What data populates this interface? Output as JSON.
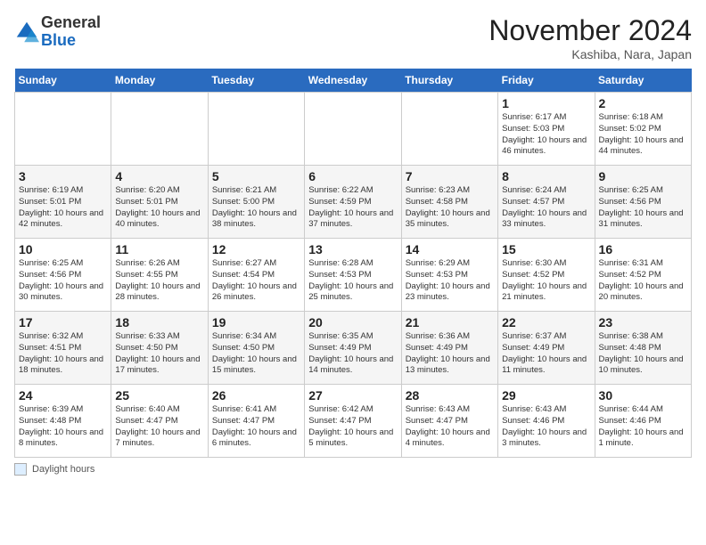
{
  "header": {
    "title": "November 2024",
    "location": "Kashiba, Nara, Japan",
    "logo_general": "General",
    "logo_blue": "Blue"
  },
  "weekdays": [
    "Sunday",
    "Monday",
    "Tuesday",
    "Wednesday",
    "Thursday",
    "Friday",
    "Saturday"
  ],
  "legend": {
    "label": "Daylight hours"
  },
  "weeks": [
    [
      {
        "date": "",
        "info": ""
      },
      {
        "date": "",
        "info": ""
      },
      {
        "date": "",
        "info": ""
      },
      {
        "date": "",
        "info": ""
      },
      {
        "date": "",
        "info": ""
      },
      {
        "date": "1",
        "info": "Sunrise: 6:17 AM\nSunset: 5:03 PM\nDaylight: 10 hours and 46 minutes."
      },
      {
        "date": "2",
        "info": "Sunrise: 6:18 AM\nSunset: 5:02 PM\nDaylight: 10 hours and 44 minutes."
      }
    ],
    [
      {
        "date": "3",
        "info": "Sunrise: 6:19 AM\nSunset: 5:01 PM\nDaylight: 10 hours and 42 minutes."
      },
      {
        "date": "4",
        "info": "Sunrise: 6:20 AM\nSunset: 5:01 PM\nDaylight: 10 hours and 40 minutes."
      },
      {
        "date": "5",
        "info": "Sunrise: 6:21 AM\nSunset: 5:00 PM\nDaylight: 10 hours and 38 minutes."
      },
      {
        "date": "6",
        "info": "Sunrise: 6:22 AM\nSunset: 4:59 PM\nDaylight: 10 hours and 37 minutes."
      },
      {
        "date": "7",
        "info": "Sunrise: 6:23 AM\nSunset: 4:58 PM\nDaylight: 10 hours and 35 minutes."
      },
      {
        "date": "8",
        "info": "Sunrise: 6:24 AM\nSunset: 4:57 PM\nDaylight: 10 hours and 33 minutes."
      },
      {
        "date": "9",
        "info": "Sunrise: 6:25 AM\nSunset: 4:56 PM\nDaylight: 10 hours and 31 minutes."
      }
    ],
    [
      {
        "date": "10",
        "info": "Sunrise: 6:25 AM\nSunset: 4:56 PM\nDaylight: 10 hours and 30 minutes."
      },
      {
        "date": "11",
        "info": "Sunrise: 6:26 AM\nSunset: 4:55 PM\nDaylight: 10 hours and 28 minutes."
      },
      {
        "date": "12",
        "info": "Sunrise: 6:27 AM\nSunset: 4:54 PM\nDaylight: 10 hours and 26 minutes."
      },
      {
        "date": "13",
        "info": "Sunrise: 6:28 AM\nSunset: 4:53 PM\nDaylight: 10 hours and 25 minutes."
      },
      {
        "date": "14",
        "info": "Sunrise: 6:29 AM\nSunset: 4:53 PM\nDaylight: 10 hours and 23 minutes."
      },
      {
        "date": "15",
        "info": "Sunrise: 6:30 AM\nSunset: 4:52 PM\nDaylight: 10 hours and 21 minutes."
      },
      {
        "date": "16",
        "info": "Sunrise: 6:31 AM\nSunset: 4:52 PM\nDaylight: 10 hours and 20 minutes."
      }
    ],
    [
      {
        "date": "17",
        "info": "Sunrise: 6:32 AM\nSunset: 4:51 PM\nDaylight: 10 hours and 18 minutes."
      },
      {
        "date": "18",
        "info": "Sunrise: 6:33 AM\nSunset: 4:50 PM\nDaylight: 10 hours and 17 minutes."
      },
      {
        "date": "19",
        "info": "Sunrise: 6:34 AM\nSunset: 4:50 PM\nDaylight: 10 hours and 15 minutes."
      },
      {
        "date": "20",
        "info": "Sunrise: 6:35 AM\nSunset: 4:49 PM\nDaylight: 10 hours and 14 minutes."
      },
      {
        "date": "21",
        "info": "Sunrise: 6:36 AM\nSunset: 4:49 PM\nDaylight: 10 hours and 13 minutes."
      },
      {
        "date": "22",
        "info": "Sunrise: 6:37 AM\nSunset: 4:49 PM\nDaylight: 10 hours and 11 minutes."
      },
      {
        "date": "23",
        "info": "Sunrise: 6:38 AM\nSunset: 4:48 PM\nDaylight: 10 hours and 10 minutes."
      }
    ],
    [
      {
        "date": "24",
        "info": "Sunrise: 6:39 AM\nSunset: 4:48 PM\nDaylight: 10 hours and 8 minutes."
      },
      {
        "date": "25",
        "info": "Sunrise: 6:40 AM\nSunset: 4:47 PM\nDaylight: 10 hours and 7 minutes."
      },
      {
        "date": "26",
        "info": "Sunrise: 6:41 AM\nSunset: 4:47 PM\nDaylight: 10 hours and 6 minutes."
      },
      {
        "date": "27",
        "info": "Sunrise: 6:42 AM\nSunset: 4:47 PM\nDaylight: 10 hours and 5 minutes."
      },
      {
        "date": "28",
        "info": "Sunrise: 6:43 AM\nSunset: 4:47 PM\nDaylight: 10 hours and 4 minutes."
      },
      {
        "date": "29",
        "info": "Sunrise: 6:43 AM\nSunset: 4:46 PM\nDaylight: 10 hours and 3 minutes."
      },
      {
        "date": "30",
        "info": "Sunrise: 6:44 AM\nSunset: 4:46 PM\nDaylight: 10 hours and 1 minute."
      }
    ]
  ]
}
